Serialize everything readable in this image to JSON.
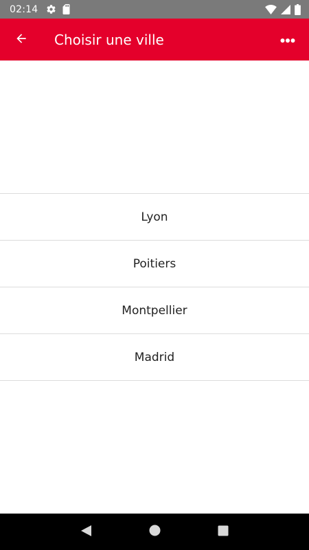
{
  "status_bar": {
    "time": "02:14",
    "left_icons": [
      "settings-icon",
      "sd-card-icon"
    ],
    "right_icons": [
      "wifi-icon",
      "cell-signal-icon",
      "battery-icon"
    ]
  },
  "app_bar": {
    "title": "Choisir une ville",
    "background_color": "#e4002b",
    "back_icon": "arrow-back-icon",
    "menu_icon": "more-horizontal-icon"
  },
  "cities": [
    {
      "label": "Lyon"
    },
    {
      "label": "Poitiers"
    },
    {
      "label": "Montpellier"
    },
    {
      "label": "Madrid"
    }
  ],
  "nav_bar": {
    "buttons": [
      "back-triangle-icon",
      "home-circle-icon",
      "recents-square-icon"
    ]
  }
}
